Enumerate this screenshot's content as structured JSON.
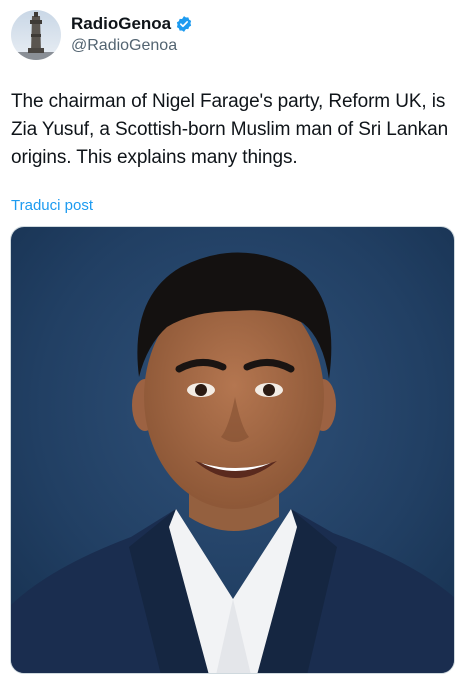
{
  "author": {
    "display_name": "RadioGenoa",
    "handle": "@RadioGenoa",
    "verified": true,
    "avatar_icon": "lighthouse-tower-avatar"
  },
  "post": {
    "text": "The chairman of Nigel Farage's party, Reform UK, is Zia Yusuf, a Scottish-born Muslim man of Sri Lankan origins. This explains many things.",
    "translate_label": "Traduci post"
  },
  "media": {
    "icon": "portrait-photo"
  },
  "colors": {
    "link": "#1d9bf0",
    "verified_badge": "#1d9bf0",
    "secondary_text": "#536471",
    "photo_background": "#1e3a5c",
    "jacket": "#1a2d4f"
  }
}
